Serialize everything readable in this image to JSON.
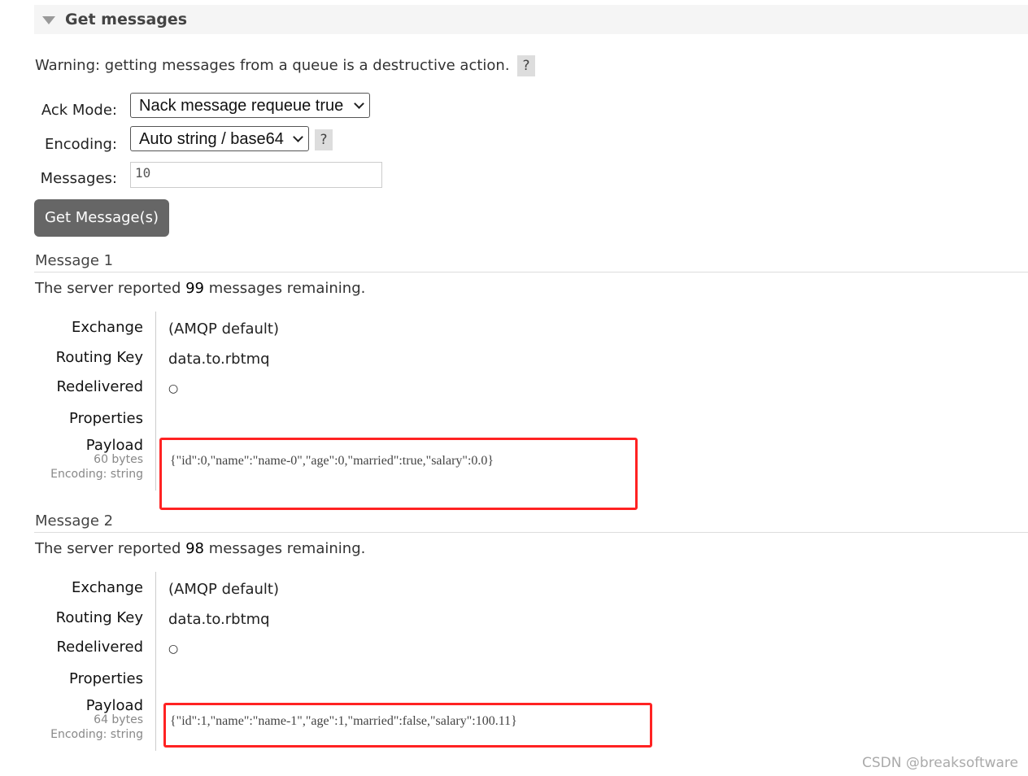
{
  "section": {
    "title": "Get messages",
    "toggle_icon": "triangle-down-icon"
  },
  "warning": "Warning: getting messages from a queue is a destructive action.",
  "help_label": "?",
  "form": {
    "ack_mode_label": "Ack Mode:",
    "ack_mode_value": "Nack message requeue true",
    "encoding_label": "Encoding:",
    "encoding_value": "Auto string / base64",
    "messages_label": "Messages:",
    "messages_value": "10",
    "submit_label": "Get Message(s)"
  },
  "labels": {
    "exchange": "Exchange",
    "routing_key": "Routing Key",
    "redelivered": "Redelivered",
    "properties": "Properties",
    "payload": "Payload"
  },
  "messages": [
    {
      "title": "Message 1",
      "remaining_prefix": "The server reported ",
      "remaining": "99",
      "remaining_suffix": " messages remaining.",
      "exchange": "(AMQP default)",
      "routing_key": "data.to.rbtmq",
      "redelivered": "○",
      "properties": "",
      "payload_size": "60 bytes",
      "payload_encoding": "Encoding: string",
      "payload": "{\"id\":0,\"name\":\"name-0\",\"age\":0,\"married\":true,\"salary\":0.0}"
    },
    {
      "title": "Message 2",
      "remaining_prefix": "The server reported ",
      "remaining": "98",
      "remaining_suffix": " messages remaining.",
      "exchange": "(AMQP default)",
      "routing_key": "data.to.rbtmq",
      "redelivered": "○",
      "properties": "",
      "payload_size": "64 bytes",
      "payload_encoding": "Encoding: string",
      "payload": "{\"id\":1,\"name\":\"name-1\",\"age\":1,\"married\":false,\"salary\":100.11}"
    }
  ],
  "highlight_color": "#ff2222",
  "watermark": "CSDN @breaksoftware"
}
